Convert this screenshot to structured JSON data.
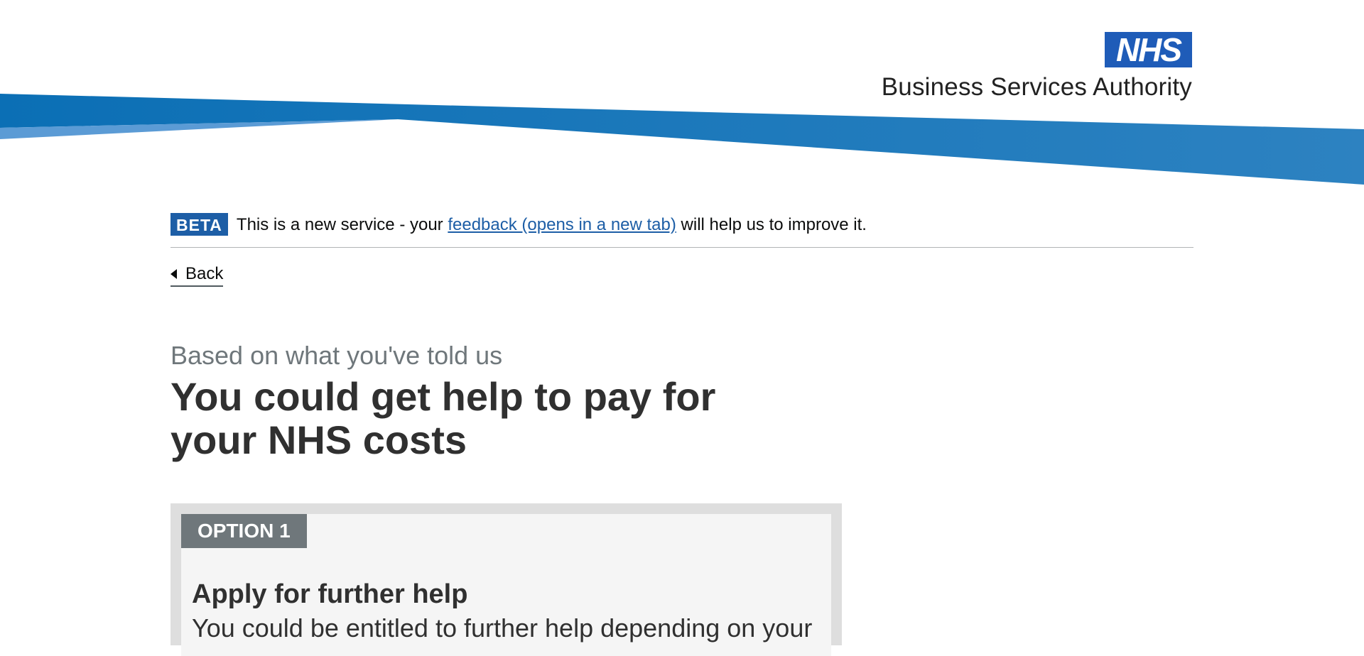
{
  "header": {
    "logo_mark": "NHS",
    "org_name": "Business Services Authority"
  },
  "phase_banner": {
    "tag": "BETA",
    "text_before": "This is a new service - your ",
    "link_text": "feedback (opens in a new tab)",
    "text_after": " will help us to improve it."
  },
  "back_link": {
    "label": "Back",
    "icon": "caret-left-icon"
  },
  "page": {
    "caption": "Based on what you've told us",
    "title": "You could get help to pay for your NHS costs"
  },
  "option": {
    "tag": "OPTION 1",
    "heading": "Apply for further help",
    "body": "You could be entitled to further help depending on your"
  },
  "colors": {
    "nhs_blue": "#1f5cb8",
    "swoosh_blue": "#1b75bb",
    "swoosh_light": "#5b9bd5",
    "beta_blue": "#1d5ea6",
    "option_tag_grey": "#6f777b"
  }
}
